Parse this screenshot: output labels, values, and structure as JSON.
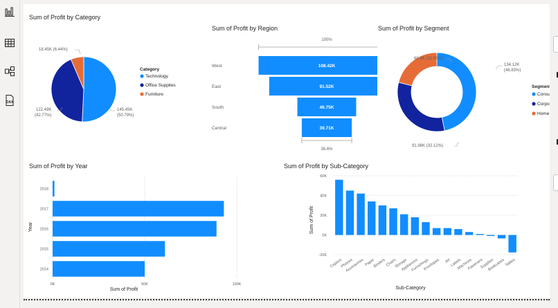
{
  "colors": {
    "blue": "#118dff",
    "navy": "#12239e",
    "orange": "#e66c37",
    "text": "#252423",
    "muted": "#605e5c",
    "grid": "#c8c6c4"
  },
  "rail": {
    "icons": [
      "report-view-icon",
      "table-view-icon",
      "model-view-icon",
      "dax-query-icon"
    ],
    "dax_label": "DAX"
  },
  "category": {
    "title": "Sum of Profit by Category",
    "legend_title": "Category",
    "labels": {
      "furniture": "18.45K (6.44%)",
      "technology_value": "145.45K",
      "technology_pct": "(50.79%)",
      "office_value": "122.49K",
      "office_pct": "(42.77%)"
    }
  },
  "region": {
    "title": "Sum of Profit by Region",
    "top_pct": "100%",
    "bottom_pct": "36.6%"
  },
  "segment": {
    "title": "Sum of Profit by Segment",
    "legend_title": "Segment",
    "labels": {
      "home_office": "60.3K (21.05%)",
      "consumer_value": "134.12K",
      "consumer_pct": "(46.83%)",
      "corporate": "91.98K (32.12%)"
    }
  },
  "year": {
    "title": "Sum of Profit by Year",
    "xlabel": "Sum of Profit",
    "ylabel": "Year",
    "ticks": [
      "0K",
      "50K",
      "100K"
    ]
  },
  "subcat": {
    "title": "Sum of Profit by Sub-Category",
    "xlabel": "Sub-Category",
    "ylabel": "Sum of Profit",
    "ticks": [
      "60K",
      "40K",
      "20K",
      "0K",
      "-20K"
    ]
  },
  "chart_data": [
    {
      "type": "pie",
      "title": "Sum of Profit by Category",
      "legend": "right",
      "categories": [
        "Technology",
        "Office Supplies",
        "Furniture"
      ],
      "values": [
        145.45,
        122.49,
        18.45
      ],
      "percents": [
        50.79,
        42.77,
        6.44
      ]
    },
    {
      "type": "bar",
      "subtype": "funnel",
      "title": "Sum of Profit by Region",
      "categories": [
        "West",
        "East",
        "South",
        "Central"
      ],
      "values": [
        108.42,
        91.52,
        46.75,
        39.71
      ],
      "value_labels": [
        "108.42K",
        "91.52K",
        "46.75K",
        "39.71K"
      ]
    },
    {
      "type": "pie",
      "subtype": "donut",
      "title": "Sum of Profit by Segment",
      "legend": "right",
      "categories": [
        "Consumer",
        "Corporate",
        "Home Office"
      ],
      "values": [
        134.12,
        91.98,
        60.3
      ],
      "percents": [
        46.83,
        32.12,
        21.05
      ]
    },
    {
      "type": "bar",
      "orientation": "horizontal",
      "title": "Sum of Profit by Year",
      "xlabel": "Sum of Profit",
      "ylabel": "Year",
      "categories": [
        "2018",
        "2017",
        "2016",
        "2015",
        "2014"
      ],
      "values": [
        1,
        93,
        89,
        61,
        50
      ],
      "xlim": [
        0,
        100
      ],
      "grid": true
    },
    {
      "type": "bar",
      "title": "Sum of Profit by Sub-Category",
      "xlabel": "Sub-Category",
      "ylabel": "Sum of Profit",
      "categories": [
        "Copiers",
        "Phones",
        "Accessories",
        "Paper",
        "Binders",
        "Chairs",
        "Storage",
        "Appliances",
        "Furnishings",
        "Envelopes",
        "Art",
        "Labels",
        "Machines",
        "Fasteners",
        "Supplies",
        "Bookcases",
        "Tables"
      ],
      "values": [
        56,
        45,
        42,
        34,
        30,
        27,
        21,
        18,
        13,
        7,
        7,
        6,
        3,
        1,
        -1,
        -3.5,
        -17.7
      ],
      "ylim": [
        -20,
        60
      ],
      "grid": true
    }
  ]
}
